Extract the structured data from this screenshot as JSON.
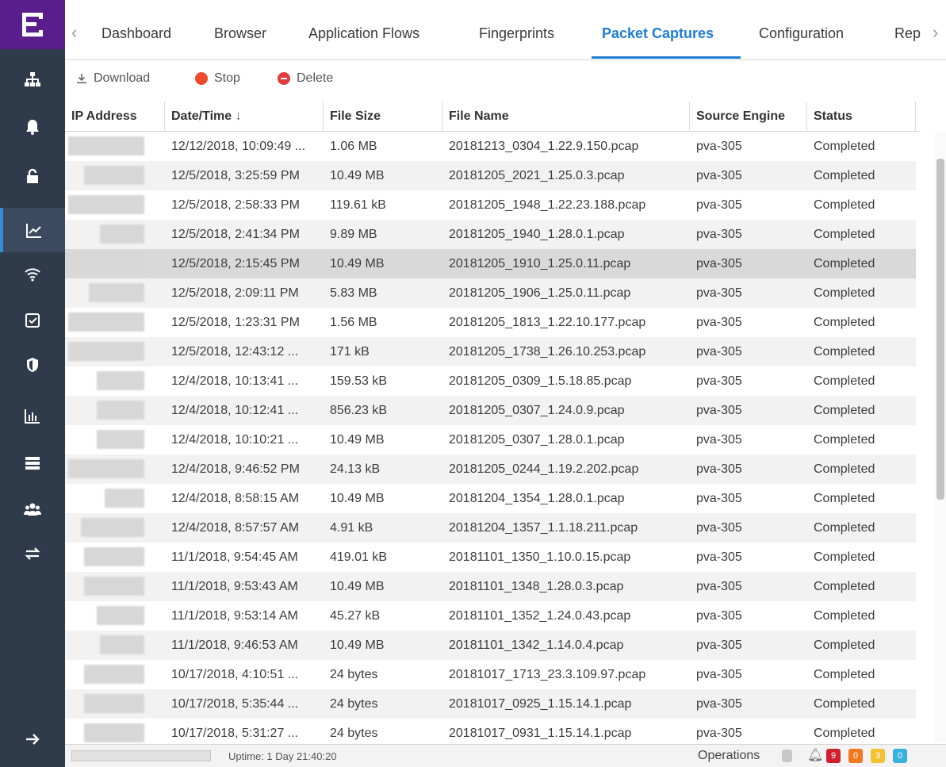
{
  "tabs": [
    {
      "label": "Dashboard"
    },
    {
      "label": "Browser"
    },
    {
      "label": "Application Flows"
    },
    {
      "label": "Fingerprints"
    },
    {
      "label": "Packet Captures",
      "active": true
    },
    {
      "label": "Configuration"
    },
    {
      "label": "Rep"
    }
  ],
  "toolbar": {
    "download_label": "Download",
    "stop_label": "Stop",
    "delete_label": "Delete"
  },
  "table": {
    "columns": [
      "IP Address",
      "Date/Time",
      "File Size",
      "File Name",
      "Source Engine",
      "Status"
    ],
    "sort_indicator": "↓",
    "rows": [
      {
        "ip": "",
        "datetime": "12/12/2018, 10:09:49 ...",
        "size": "1.06 MB",
        "file": "20181213_0304_1.22.9.150.pcap",
        "engine": "pva-305",
        "status": "Completed"
      },
      {
        "ip": "",
        "datetime": "12/5/2018, 3:25:59 PM",
        "size": "10.49 MB",
        "file": "20181205_2021_1.25.0.3.pcap",
        "engine": "pva-305",
        "status": "Completed"
      },
      {
        "ip": "",
        "datetime": "12/5/2018, 2:58:33 PM",
        "size": "119.61 kB",
        "file": "20181205_1948_1.22.23.188.pcap",
        "engine": "pva-305",
        "status": "Completed"
      },
      {
        "ip": "",
        "datetime": "12/5/2018, 2:41:34 PM",
        "size": "9.89 MB",
        "file": "20181205_1940_1.28.0.1.pcap",
        "engine": "pva-305",
        "status": "Completed"
      },
      {
        "ip": "",
        "datetime": "12/5/2018, 2:15:45 PM",
        "size": "10.49 MB",
        "file": "20181205_1910_1.25.0.11.pcap",
        "engine": "pva-305",
        "status": "Completed",
        "selected": true
      },
      {
        "ip": "",
        "datetime": "12/5/2018, 2:09:11 PM",
        "size": "5.83 MB",
        "file": "20181205_1906_1.25.0.11.pcap",
        "engine": "pva-305",
        "status": "Completed"
      },
      {
        "ip": "",
        "datetime": "12/5/2018, 1:23:31 PM",
        "size": "1.56 MB",
        "file": "20181205_1813_1.22.10.177.pcap",
        "engine": "pva-305",
        "status": "Completed"
      },
      {
        "ip": "",
        "datetime": "12/5/2018, 12:43:12 ...",
        "size": "171 kB",
        "file": "20181205_1738_1.26.10.253.pcap",
        "engine": "pva-305",
        "status": "Completed"
      },
      {
        "ip": "",
        "datetime": "12/4/2018, 10:13:41 ...",
        "size": "159.53 kB",
        "file": "20181205_0309_1.5.18.85.pcap",
        "engine": "pva-305",
        "status": "Completed"
      },
      {
        "ip": "",
        "datetime": "12/4/2018, 10:12:41 ...",
        "size": "856.23 kB",
        "file": "20181205_0307_1.24.0.9.pcap",
        "engine": "pva-305",
        "status": "Completed"
      },
      {
        "ip": "",
        "datetime": "12/4/2018, 10:10:21 ...",
        "size": "10.49 MB",
        "file": "20181205_0307_1.28.0.1.pcap",
        "engine": "pva-305",
        "status": "Completed"
      },
      {
        "ip": "",
        "datetime": "12/4/2018, 9:46:52 PM",
        "size": "24.13 kB",
        "file": "20181205_0244_1.19.2.202.pcap",
        "engine": "pva-305",
        "status": "Completed"
      },
      {
        "ip": "",
        "datetime": "12/4/2018, 8:58:15 AM",
        "size": "10.49 MB",
        "file": "20181204_1354_1.28.0.1.pcap",
        "engine": "pva-305",
        "status": "Completed"
      },
      {
        "ip": "",
        "datetime": "12/4/2018, 8:57:57 AM",
        "size": "4.91 kB",
        "file": "20181204_1357_1.1.18.211.pcap",
        "engine": "pva-305",
        "status": "Completed"
      },
      {
        "ip": "",
        "datetime": "11/1/2018, 9:54:45 AM",
        "size": "419.01 kB",
        "file": "20181101_1350_1.10.0.15.pcap",
        "engine": "pva-305",
        "status": "Completed"
      },
      {
        "ip": "",
        "datetime": "11/1/2018, 9:53:43 AM",
        "size": "10.49 MB",
        "file": "20181101_1348_1.28.0.3.pcap",
        "engine": "pva-305",
        "status": "Completed"
      },
      {
        "ip": "",
        "datetime": "11/1/2018, 9:53:14 AM",
        "size": "45.27 kB",
        "file": "20181101_1352_1.24.0.43.pcap",
        "engine": "pva-305",
        "status": "Completed"
      },
      {
        "ip": "",
        "datetime": "11/1/2018, 9:46:53 AM",
        "size": "10.49 MB",
        "file": "20181101_1342_1.14.0.4.pcap",
        "engine": "pva-305",
        "status": "Completed"
      },
      {
        "ip": "",
        "datetime": "10/17/2018, 4:10:51 ...",
        "size": "24 bytes",
        "file": "20181017_1713_23.3.109.97.pcap",
        "engine": "pva-305",
        "status": "Completed"
      },
      {
        "ip": "",
        "datetime": "10/17/2018, 5:35:44 ...",
        "size": "24 bytes",
        "file": "20181017_0925_1.15.14.1.pcap",
        "engine": "pva-305",
        "status": "Completed"
      },
      {
        "ip": "",
        "datetime": "10/17/2018, 5:31:27 ...",
        "size": "24 bytes",
        "file": "20181017_0931_1.15.14.1.pcap",
        "engine": "pva-305",
        "status": "Completed"
      }
    ]
  },
  "footer": {
    "uptime": "Uptime: 1 Day 21:40:20",
    "operations_label": "Operations",
    "badges": [
      {
        "value": "9",
        "color": "#d0202e"
      },
      {
        "value": "0",
        "color": "#f07a20"
      },
      {
        "value": "3",
        "color": "#f2c230"
      },
      {
        "value": "0",
        "color": "#3ab0e0"
      }
    ]
  },
  "sidebar": {
    "icons": [
      "network-icon",
      "bell-icon",
      "lock-icon",
      "analytics-icon",
      "wifi-icon",
      "checkbox-icon",
      "shield-icon",
      "bar-chart-icon",
      "server-icon",
      "users-icon",
      "transfer-icon",
      "arrow-right-icon"
    ],
    "active": "analytics-icon"
  },
  "colors": {
    "sidebar_bg": "#2f3a4a",
    "logo_bg": "#5a1e8c",
    "accent": "#1f7dd4"
  }
}
